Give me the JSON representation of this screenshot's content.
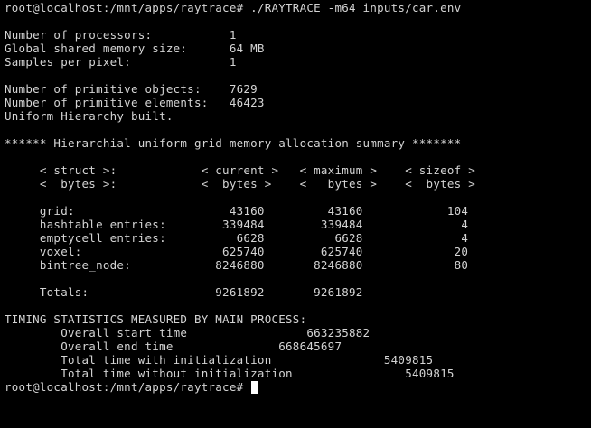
{
  "terminal": {
    "lines": [
      "root@localhost:/mnt/apps/raytrace# ./RAYTRACE -m64 inputs/car.env",
      "",
      "Number of processors:           1",
      "Global shared memory size:      64 MB",
      "Samples per pixel:              1",
      "",
      "Number of primitive objects:    7629",
      "Number of primitive elements:   46423",
      "Uniform Hierarchy built.",
      "",
      "****** Hierarchial uniform grid memory allocation summary *******",
      "",
      "     < struct >:            < current >   < maximum >    < sizeof >",
      "     <  bytes >:            <  bytes >    <   bytes >    <  bytes >",
      "",
      "     grid:                      43160         43160            104",
      "     hashtable entries:        339484        339484              4",
      "     emptycell entries:          6628          6628              4",
      "     voxel:                    625740        625740             20",
      "     bintree_node:            8246880       8246880             80",
      "",
      "     Totals:                  9261892       9261892",
      "",
      "TIMING STATISTICS MEASURED BY MAIN PROCESS:",
      "        Overall start time                 663235882",
      "        Overall end time               668645697",
      "        Total time with initialization                5409815",
      "        Total time without initialization                5409815"
    ],
    "prompt": "root@localhost:/mnt/apps/raytrace# "
  }
}
